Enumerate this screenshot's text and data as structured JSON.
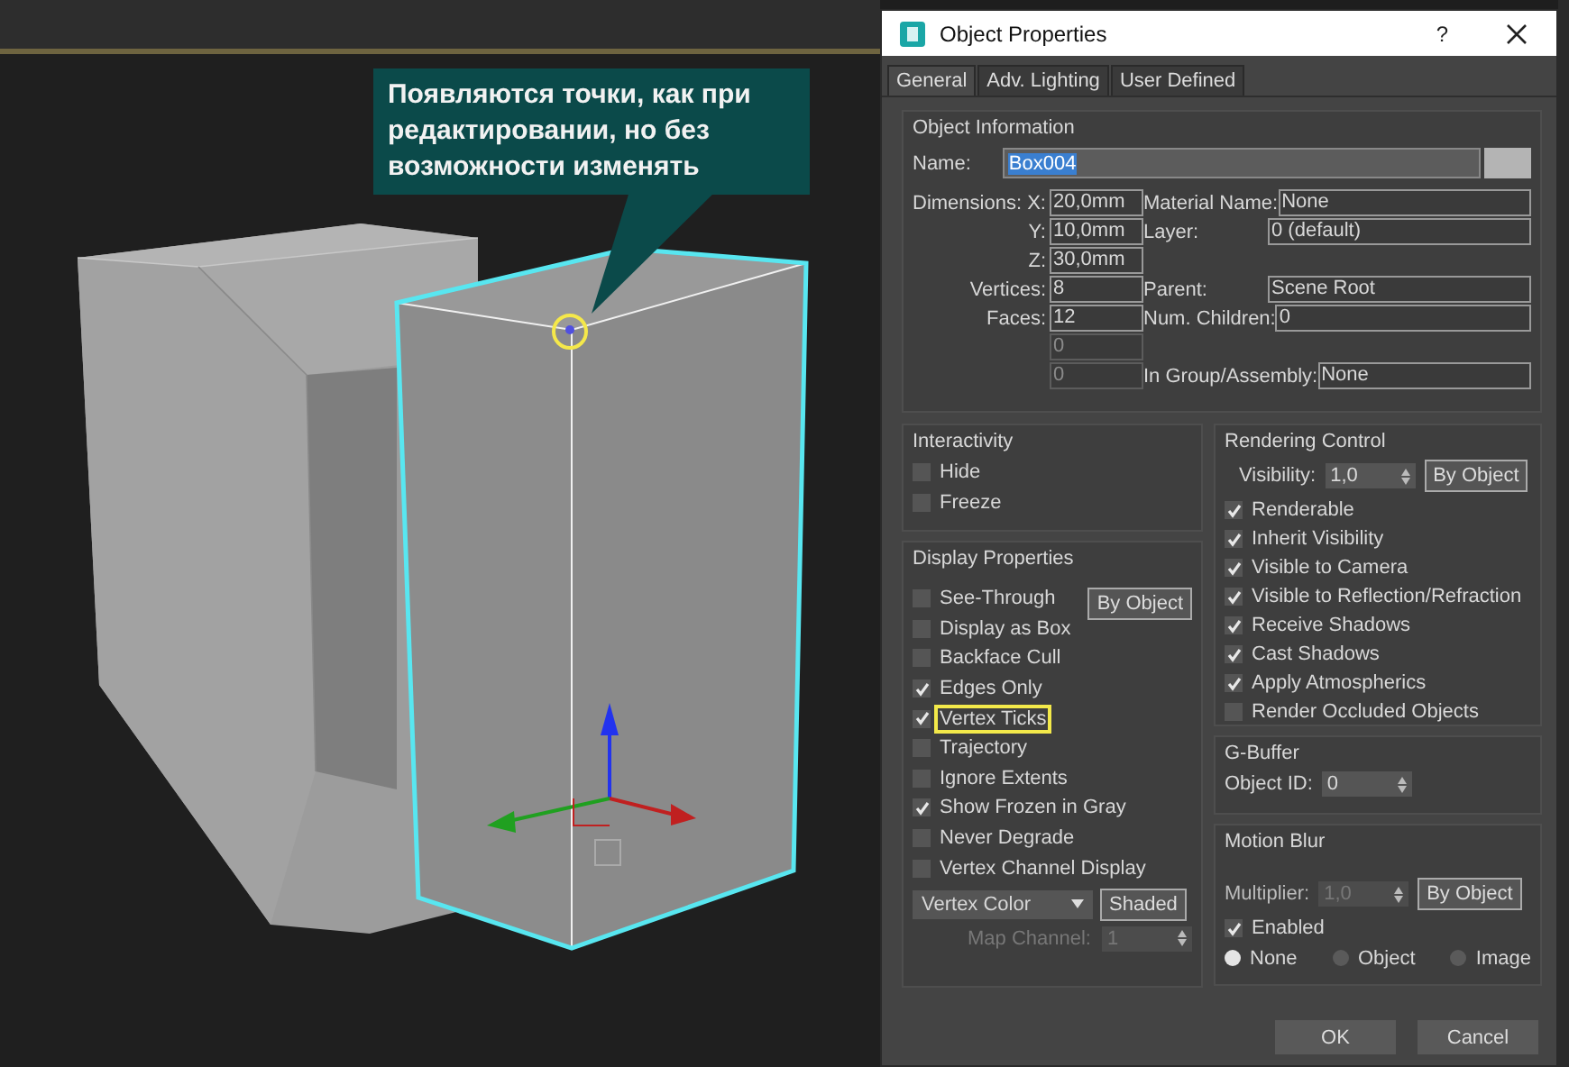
{
  "viewport": {
    "callout": "Появляются точки, как при редактировании, но без возможности изменять"
  },
  "dialog": {
    "title": "Object Properties",
    "help": "?",
    "tabs": [
      {
        "label": "General",
        "selected": true
      },
      {
        "label": "Adv. Lighting",
        "selected": false
      },
      {
        "label": "User Defined",
        "selected": false
      }
    ],
    "object_info": {
      "title": "Object Information",
      "name_label": "Name:",
      "name_value": "Box004",
      "rows": [
        {
          "label": "Dimensions:",
          "axis": "X:",
          "value": "20,0mm",
          "prop_label": "Material Name:",
          "prop_value": "None",
          "disabled": false
        },
        {
          "axis": "Y:",
          "value": "10,0mm",
          "prop_label": "Layer:",
          "prop_value": "0 (default)",
          "disabled": false
        },
        {
          "axis": "Z:",
          "value": "30,0mm",
          "disabled": false
        },
        {
          "label": "Vertices:",
          "value": "8",
          "prop_label": "Parent:",
          "prop_value": "Scene Root",
          "disabled": false
        },
        {
          "label": "Faces:",
          "value": "12",
          "prop_label": "Num. Children:",
          "prop_value": "0",
          "disabled": false
        },
        {
          "value": "0",
          "disabled": true
        },
        {
          "value": "0",
          "disabled": true,
          "prop_label": "In Group/Assembly:",
          "prop_value": "None"
        }
      ]
    },
    "interactivity": {
      "title": "Interactivity",
      "items": [
        {
          "label": "Hide",
          "checked": false
        },
        {
          "label": "Freeze",
          "checked": false
        }
      ]
    },
    "display": {
      "title": "Display Properties",
      "by_object": "By Object",
      "items": [
        {
          "label": "See-Through",
          "checked": false,
          "highlighted": false
        },
        {
          "label": "Display as Box",
          "checked": false,
          "highlighted": false
        },
        {
          "label": "Backface Cull",
          "checked": false,
          "highlighted": false
        },
        {
          "label": "Edges Only",
          "checked": true,
          "highlighted": false
        },
        {
          "label": "Vertex Ticks",
          "checked": true,
          "highlighted": true
        },
        {
          "label": "Trajectory",
          "checked": false,
          "highlighted": false
        },
        {
          "label": "Ignore Extents",
          "checked": false,
          "highlighted": false
        },
        {
          "label": "Show Frozen in Gray",
          "checked": true,
          "highlighted": false
        },
        {
          "label": "Never Degrade",
          "checked": false,
          "highlighted": false
        },
        {
          "label": "Vertex Channel Display",
          "checked": false,
          "highlighted": false
        }
      ],
      "vertex_color": "Vertex Color",
      "shaded": "Shaded",
      "map_channel_label": "Map Channel:",
      "map_channel_value": "1",
      "map_channel_disabled": true
    },
    "rendering": {
      "title": "Rendering Control",
      "visibility_label": "Visibility:",
      "visibility_value": "1,0",
      "by_object": "By Object",
      "items": [
        {
          "label": "Renderable",
          "checked": true
        },
        {
          "label": "Inherit Visibility",
          "checked": true
        },
        {
          "label": "Visible to Camera",
          "checked": true
        },
        {
          "label": "Visible to Reflection/Refraction",
          "checked": true
        },
        {
          "label": "Receive Shadows",
          "checked": true
        },
        {
          "label": "Cast Shadows",
          "checked": true
        },
        {
          "label": "Apply Atmospherics",
          "checked": true
        },
        {
          "label": "Render Occluded Objects",
          "checked": false
        }
      ]
    },
    "gbuffer": {
      "title": "G-Buffer",
      "object_id_label": "Object ID:",
      "object_id_value": "0"
    },
    "motion_blur": {
      "title": "Motion Blur",
      "multiplier_label": "Multiplier:",
      "multiplier_value": "1,0",
      "multiplier_disabled": true,
      "by_object": "By Object",
      "enabled": {
        "label": "Enabled",
        "checked": true
      },
      "types": [
        {
          "label": "None",
          "selected": true
        },
        {
          "label": "Object",
          "selected": false
        },
        {
          "label": "Image",
          "selected": false
        }
      ]
    },
    "buttons": [
      "OK",
      "Cancel"
    ]
  }
}
